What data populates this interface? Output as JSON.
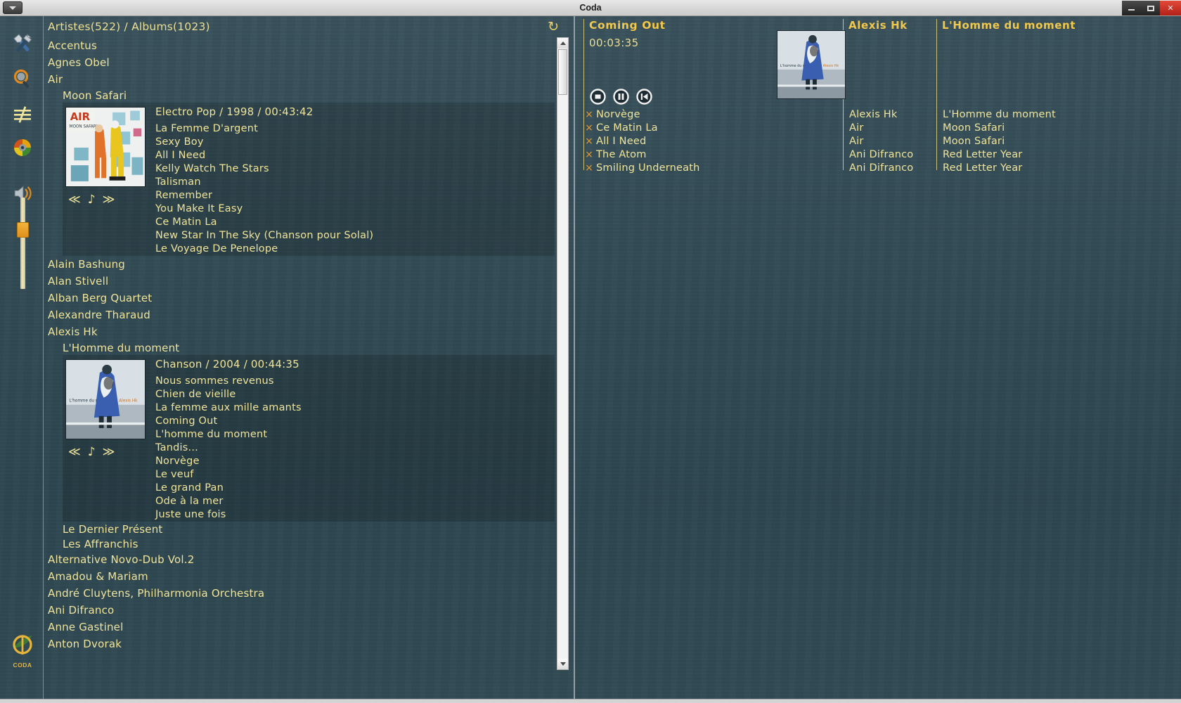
{
  "window": {
    "title": "Coda",
    "menu_button": "app-menu",
    "controls": {
      "minimize": "–",
      "maximize": "□",
      "close": "✕"
    }
  },
  "toolbar": {
    "items": [
      {
        "name": "tools-icon",
        "label": "Tools"
      },
      {
        "name": "search-icon",
        "label": "Search"
      },
      {
        "name": "equalizer-icon",
        "label": "Equalizer"
      },
      {
        "name": "disc-icon",
        "label": "Disc"
      },
      {
        "name": "volume-icon",
        "label": "Volume"
      }
    ],
    "volume_slider": "volume-slider",
    "logo_text": "CODA"
  },
  "library": {
    "counts": "Artistes(522) / Albums(1023)",
    "refresh_icon": "↻",
    "entries": [
      {
        "type": "artist",
        "name": "Accentus"
      },
      {
        "type": "artist",
        "name": "Agnes Obel"
      },
      {
        "type": "artist",
        "name": "Air"
      },
      {
        "type": "album",
        "name": "Moon Safari",
        "meta": "Electro Pop / 1998 / 00:43:42",
        "cover": "air-moon-safari",
        "controls": [
          "prev",
          "play",
          "next"
        ],
        "tracks": [
          "La Femme D'argent",
          "Sexy Boy",
          "All I Need",
          "Kelly Watch The Stars",
          "Talisman",
          "Remember",
          "You Make It Easy",
          "Ce Matin La",
          "New Star In The Sky (Chanson pour Solal)",
          "Le Voyage De Penelope"
        ]
      },
      {
        "type": "artist",
        "name": "Alain Bashung"
      },
      {
        "type": "artist",
        "name": "Alan Stivell"
      },
      {
        "type": "artist",
        "name": "Alban Berg Quartet"
      },
      {
        "type": "artist",
        "name": "Alexandre Tharaud"
      },
      {
        "type": "artist",
        "name": "Alexis Hk"
      },
      {
        "type": "album",
        "name": "L'Homme du moment",
        "meta": "Chanson / 2004 / 00:44:35",
        "cover": "alexis-hk-homme",
        "controls": [
          "prev",
          "play",
          "next"
        ],
        "tracks": [
          "Nous sommes revenus",
          "Chien de vieille",
          "La femme aux mille amants",
          "Coming Out",
          "L'homme du moment",
          "Tandis...",
          "Norvège",
          "Le veuf",
          "Le grand Pan",
          "Ode à la mer",
          "Juste une fois"
        ]
      },
      {
        "type": "album-name",
        "name": "Le Dernier Présent"
      },
      {
        "type": "album-name",
        "name": "Les Affranchis"
      },
      {
        "type": "artist",
        "name": "Alternative Novo-Dub Vol.2"
      },
      {
        "type": "artist",
        "name": "Amadou & Mariam"
      },
      {
        "type": "artist",
        "name": "André Cluytens, Philharmonia Orchestra"
      },
      {
        "type": "artist",
        "name": "Ani Difranco"
      },
      {
        "type": "artist",
        "name": "Anne Gastinel"
      },
      {
        "type": "artist",
        "name": "Anton Dvorak"
      }
    ]
  },
  "player": {
    "now_playing": {
      "title": "Coming Out",
      "elapsed": "00:03:35",
      "cover": "alexis-hk-homme"
    },
    "buttons": [
      {
        "name": "stop-button",
        "glyph": "stop"
      },
      {
        "name": "pause-button",
        "glyph": "pause"
      },
      {
        "name": "previous-button",
        "glyph": "previous"
      }
    ],
    "columns": {
      "artist": "Alexis Hk",
      "album": "L'Homme du moment"
    },
    "queue": [
      {
        "remove": "×",
        "title": "Norvège",
        "artist": "Alexis Hk",
        "album": "L'Homme du moment"
      },
      {
        "remove": "×",
        "title": "Ce Matin La",
        "artist": "Air",
        "album": "Moon Safari"
      },
      {
        "remove": "×",
        "title": "All I Need",
        "artist": "Air",
        "album": "Moon Safari"
      },
      {
        "remove": "×",
        "title": "The Atom",
        "artist": "Ani Difranco",
        "album": "Red Letter Year"
      },
      {
        "remove": "×",
        "title": "Smiling Underneath",
        "artist": "Ani Difranco",
        "album": "Red Letter Year"
      }
    ]
  },
  "colors": {
    "text": "#efe49a",
    "accent": "#f2c84a",
    "remove": "#e89a28",
    "background": "#2e4650"
  }
}
